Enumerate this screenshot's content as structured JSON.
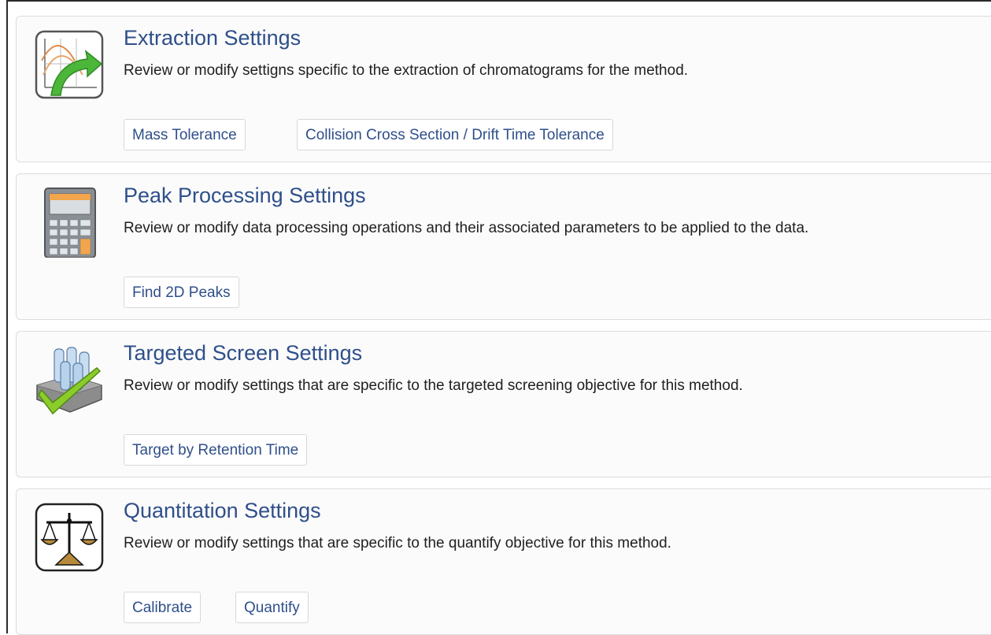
{
  "sections": [
    {
      "title": "Extraction Settings",
      "description": "Review or modify settigns specific to the extraction of chromatograms for the method.",
      "icon": "extraction-chart-arrow-icon",
      "buttons": [
        "Mass Tolerance",
        "Collision Cross Section / Drift Time Tolerance"
      ]
    },
    {
      "title": "Peak Processing Settings",
      "description": "Review or modify data processing operations and their associated parameters to be applied to the data.",
      "icon": "calculator-icon",
      "buttons": [
        "Find 2D Peaks"
      ]
    },
    {
      "title": "Targeted Screen Settings",
      "description": "Review or modify settings that are specific to the targeted screening objective for this method.",
      "icon": "vials-checkmark-icon",
      "buttons": [
        "Target by Retention Time"
      ]
    },
    {
      "title": "Quantitation Settings",
      "description": "Review or modify settings that are specific to the quantify objective for this method.",
      "icon": "balance-scale-icon",
      "buttons": [
        "Calibrate",
        "Quantify"
      ]
    }
  ],
  "colors": {
    "title": "#2f4f8a",
    "text": "#1f1f1f",
    "panel_bg": "#fbfbfb",
    "border": "#dcdcdc",
    "accent_green": "#3fae2a",
    "scale_gold": "#b68a3a"
  }
}
